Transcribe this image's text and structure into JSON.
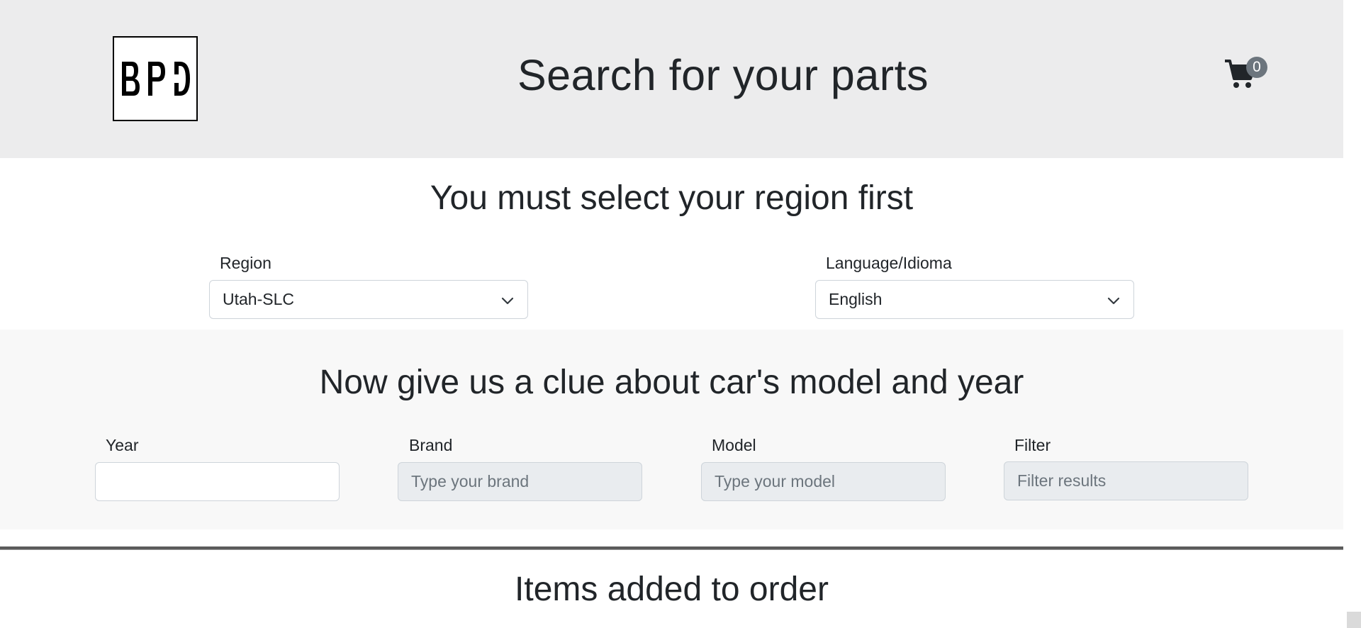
{
  "header": {
    "logo_text": "BPD",
    "title": "Search for your parts",
    "cart_count": "0",
    "cart_icon": "shopping-cart-icon"
  },
  "region_section": {
    "title": "You must select your region first",
    "region": {
      "label": "Region",
      "selected": "Utah-SLC"
    },
    "language": {
      "label": "Language/Idioma",
      "selected": "English"
    }
  },
  "car_section": {
    "title": "Now give us a clue about car's model and year",
    "year": {
      "label": "Year",
      "value": "",
      "placeholder": ""
    },
    "brand": {
      "label": "Brand",
      "value": "",
      "placeholder": "Type your brand"
    },
    "model": {
      "label": "Model",
      "value": "",
      "placeholder": "Type your model"
    },
    "filter": {
      "label": "Filter",
      "value": "",
      "placeholder": "Filter results"
    }
  },
  "order_section": {
    "title": "Items added to order"
  },
  "colors": {
    "header_bg": "#ececed",
    "car_section_bg": "#f8f8f8",
    "disabled_input_bg": "#e9ecef",
    "badge_bg": "#6c757d",
    "divider": "#5b5b5b"
  }
}
